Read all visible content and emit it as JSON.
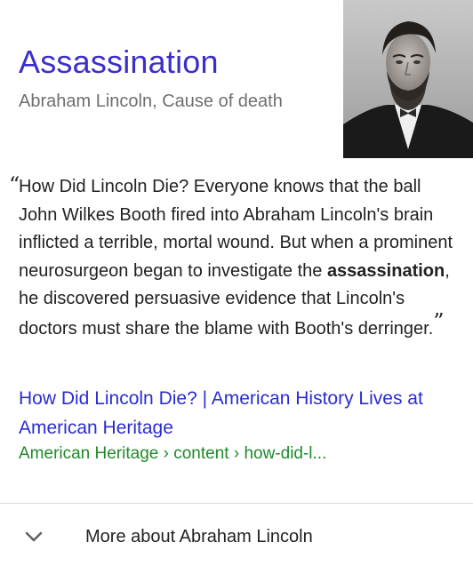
{
  "header": {
    "title": "Assassination",
    "subtitle": "Abraham Lincoln, Cause of death",
    "image_alt": "Portrait of Abraham Lincoln"
  },
  "snippet": {
    "quote_before": "How Did Lincoln Die? Everyone knows that the ball John Wilkes Booth fired into Abraham Lincoln's brain inflicted a terrible, mortal wound. But when a prominent neurosurgeon began to investigate the ",
    "quote_bold": "assassination",
    "quote_after": ", he discovered persuasive evidence that Lincoln's doctors must share the blame with Booth's derringer.",
    "open_quote": "“",
    "close_quote": "”"
  },
  "source": {
    "link_text": "How Did Lincoln Die? | American History Lives at American Heritage",
    "url_text": "American Heritage › content › how-did-l..."
  },
  "more": {
    "label": "More about Abraham Lincoln",
    "icon": "chevron-down-icon"
  },
  "colors": {
    "title": "#3b2fc9",
    "link": "#2a2dd0",
    "url": "#1f8a2a",
    "text": "#222222",
    "subtle": "#6f6f6f"
  }
}
